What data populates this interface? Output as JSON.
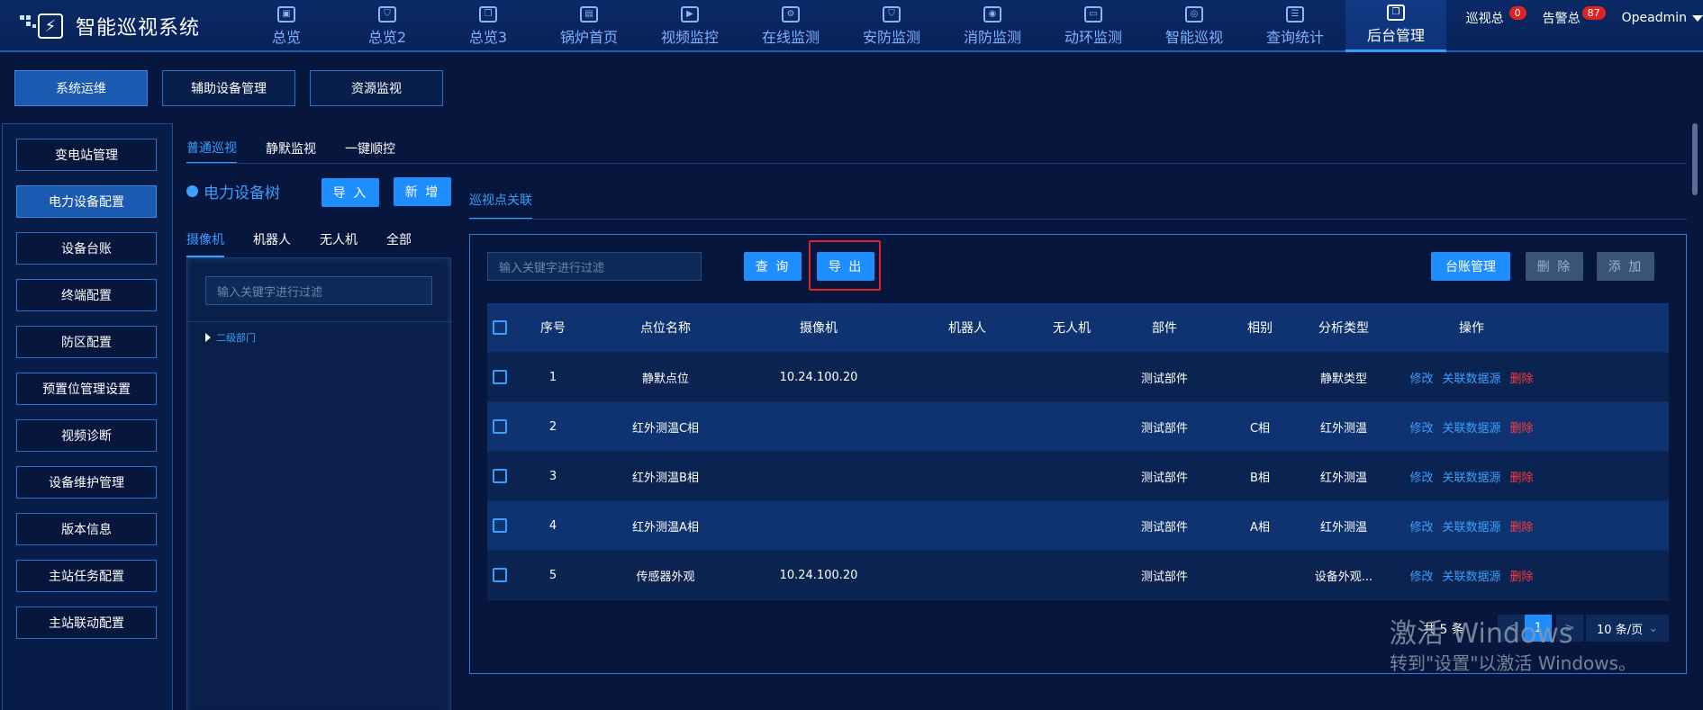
{
  "app": {
    "title": "智能巡视系统"
  },
  "nav": [
    {
      "label": "总览",
      "icon": "monitor-icon"
    },
    {
      "label": "总览2",
      "icon": "shield-icon"
    },
    {
      "label": "总览3",
      "icon": "book-icon"
    },
    {
      "label": "锅炉首页",
      "icon": "image-icon"
    },
    {
      "label": "视频监控",
      "icon": "play-icon"
    },
    {
      "label": "在线监测",
      "icon": "gear-icon"
    },
    {
      "label": "安防监测",
      "icon": "shield-icon"
    },
    {
      "label": "消防监测",
      "icon": "camera-icon"
    },
    {
      "label": "动环监测",
      "icon": "screen-icon"
    },
    {
      "label": "智能巡视",
      "icon": "eye-icon"
    },
    {
      "label": "查询统计",
      "icon": "document-icon"
    },
    {
      "label": "后台管理",
      "icon": "book-icon"
    }
  ],
  "top_right": {
    "patrol_label": "巡视总",
    "patrol_count": "0",
    "alarm_label": "告警总",
    "alarm_count": "87",
    "user": "Opeadmin"
  },
  "subtabs": [
    "系统运维",
    "辅助设备管理",
    "资源监视"
  ],
  "sidebar": [
    "变电站管理",
    "电力设备配置",
    "设备台账",
    "终端配置",
    "防区配置",
    "预置位管理设置",
    "视频诊断",
    "设备维护管理",
    "版本信息",
    "主站任务配置",
    "主站联动配置"
  ],
  "mode_tabs": [
    "普通巡视",
    "静默监视",
    "一键顺控"
  ],
  "tree": {
    "title": "电力设备树",
    "import_label": "导 入",
    "new_label": "新 增",
    "type_tabs": [
      "摄像机",
      "机器人",
      "无人机",
      "全部"
    ],
    "filter_placeholder": "输入关键字进行过滤",
    "node": "二级部门"
  },
  "main": {
    "tab": "巡视点关联",
    "filter_placeholder": "输入关键字进行过滤",
    "query_label": "查 询",
    "export_label": "导 出",
    "ledger_label": "台账管理",
    "delete_label": "删 除",
    "add_label": "添 加"
  },
  "table": {
    "headers": [
      "序号",
      "点位名称",
      "摄像机",
      "机器人",
      "无人机",
      "部件",
      "相别",
      "分析类型",
      "操作"
    ],
    "rows": [
      {
        "no": "1",
        "name": "静默点位",
        "camera": "10.24.100.20",
        "robot": "",
        "drone": "",
        "part": "测试部件",
        "phase": "",
        "type": "静默类型"
      },
      {
        "no": "2",
        "name": "红外测温C相",
        "camera": "",
        "robot": "",
        "drone": "",
        "part": "测试部件",
        "phase": "C相",
        "type": "红外测温"
      },
      {
        "no": "3",
        "name": "红外测温B相",
        "camera": "",
        "robot": "",
        "drone": "",
        "part": "测试部件",
        "phase": "B相",
        "type": "红外测温"
      },
      {
        "no": "4",
        "name": "红外测温A相",
        "camera": "",
        "robot": "",
        "drone": "",
        "part": "测试部件",
        "phase": "A相",
        "type": "红外测温"
      },
      {
        "no": "5",
        "name": "传感器外观",
        "camera": "10.24.100.20",
        "robot": "",
        "drone": "",
        "part": "测试部件",
        "phase": "",
        "type": "设备外观..."
      }
    ],
    "actions": {
      "edit": "修改",
      "link": "关联数据源",
      "delete": "删除"
    }
  },
  "pagination": {
    "total": "共 5 条",
    "current": "1",
    "prev": "<",
    "next": ">",
    "page_size": "10 条/页"
  },
  "watermark": {
    "line1": "激活 Windows",
    "line2": "转到\"设置\"以激活 Windows。"
  }
}
